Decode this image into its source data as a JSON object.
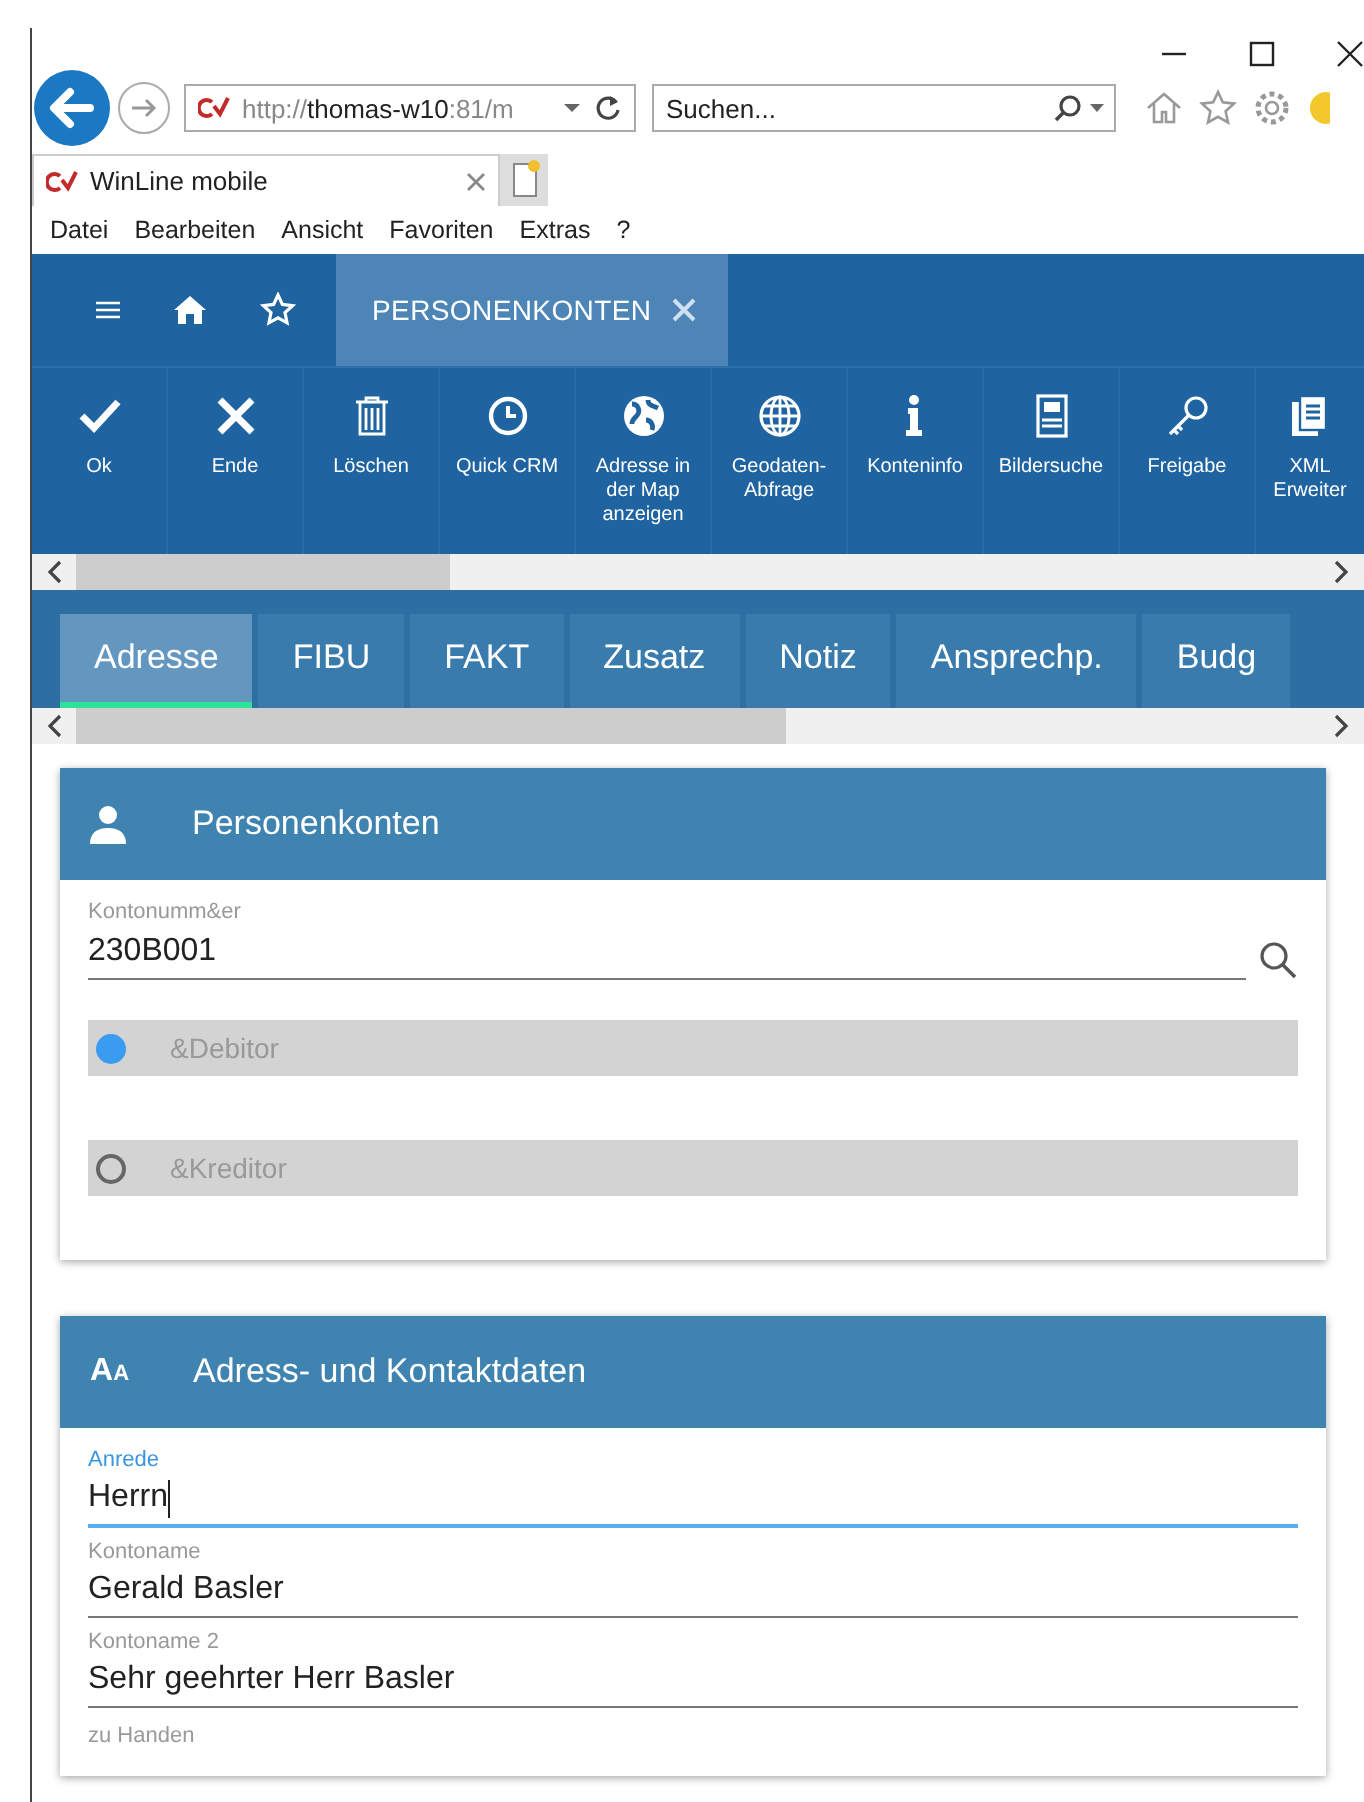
{
  "browser": {
    "address": "http://**thomas-w10**:81/m",
    "search_placeholder": "Suchen...",
    "tab_title": "WinLine mobile",
    "menu": [
      "Datei",
      "Bearbeiten",
      "Ansicht",
      "Favoriten",
      "Extras",
      "?"
    ]
  },
  "app_nav": {
    "open_tab": {
      "label": "PERSONENKONTEN",
      "selected": true
    }
  },
  "toolbar": [
    {
      "kind": "check",
      "label": "Ok"
    },
    {
      "kind": "cross",
      "label": "Ende"
    },
    {
      "kind": "trash",
      "label": "Löschen"
    },
    {
      "kind": "clock",
      "label": "Quick CRM"
    },
    {
      "kind": "earth",
      "label": "Adresse in der Map anzeigen"
    },
    {
      "kind": "globe",
      "label": "Geodaten-Abfrage"
    },
    {
      "kind": "info",
      "label": "Konteninfo"
    },
    {
      "kind": "document",
      "label": "Bildersuche"
    },
    {
      "kind": "key",
      "label": "Freigabe"
    },
    {
      "kind": "documents",
      "label": "XML Erweiter"
    }
  ],
  "tabs": [
    {
      "label": "Adresse",
      "selected": true
    },
    {
      "label": "FIBU",
      "selected": false
    },
    {
      "label": "FAKT",
      "selected": false
    },
    {
      "label": "Zusatz",
      "selected": false
    },
    {
      "label": "Notiz",
      "selected": false
    },
    {
      "label": "Ansprechp.",
      "selected": false
    },
    {
      "label": "Budg",
      "selected": false
    }
  ],
  "sections": [
    {
      "kind": "person",
      "title": "Personenkonten",
      "fields": [
        {
          "kind": "lookup",
          "label": "Kontonumm&er",
          "value": "230B001",
          "focused": false
        },
        {
          "kind": "radio",
          "label": "&Debitor",
          "selected": true,
          "disabled": true
        },
        {
          "kind": "radio",
          "label": "&Kreditor",
          "selected": false,
          "disabled": true
        }
      ]
    },
    {
      "kind": "letters",
      "icon_text": [
        "A",
        "A"
      ],
      "title": "Adress- und Kontaktdaten",
      "fields": [
        {
          "kind": "text",
          "label": "Anrede",
          "value": "Herrn",
          "focused": true
        },
        {
          "kind": "text",
          "label": "Kontoname",
          "value": "Gerald Basler",
          "focused": false
        },
        {
          "kind": "text",
          "label": "Kontoname 2",
          "value": "Sehr geehrter Herr Basler",
          "focused": false
        },
        {
          "kind": "label",
          "label": "zu Handen"
        }
      ]
    }
  ]
}
